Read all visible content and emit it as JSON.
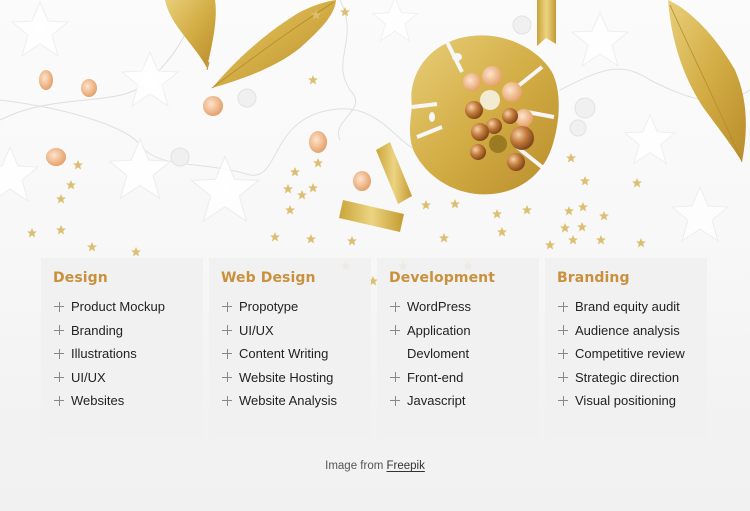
{
  "hero": {
    "image_description": "Flat lay of gold feathers, gold monstera leaf dish with copper beads, gold star confetti and peach crystal beads on white",
    "accent_color": "#c9913d",
    "gold_color": "#d4b04a"
  },
  "cards": [
    {
      "title": "Design",
      "items": [
        {
          "label": "Product Mockup",
          "bullet": true
        },
        {
          "label": "Branding",
          "bullet": true
        },
        {
          "label": "Illustrations",
          "bullet": true
        },
        {
          "label": "UI/UX",
          "bullet": true
        },
        {
          "label": "Websites",
          "bullet": true
        }
      ]
    },
    {
      "title": "Web Design",
      "items": [
        {
          "label": "Propotype",
          "bullet": true
        },
        {
          "label": "UI/UX",
          "bullet": true
        },
        {
          "label": "Content Writing",
          "bullet": true
        },
        {
          "label": "Website Hosting",
          "bullet": true
        },
        {
          "label": "Website Analysis",
          "bullet": true
        }
      ]
    },
    {
      "title": "Development",
      "items": [
        {
          "label": "WordPress",
          "bullet": true
        },
        {
          "label": "Application",
          "bullet": true
        },
        {
          "label": "Devloment",
          "bullet": false
        },
        {
          "label": "Front-end",
          "bullet": true
        },
        {
          "label": "Javascript",
          "bullet": true
        }
      ]
    },
    {
      "title": "Branding",
      "items": [
        {
          "label": "Brand equity audit",
          "bullet": true
        },
        {
          "label": "Audience analysis",
          "bullet": true
        },
        {
          "label": "Competitive review",
          "bullet": true
        },
        {
          "label": "Strategic direction",
          "bullet": true
        },
        {
          "label": "Visual positioning",
          "bullet": true
        }
      ]
    }
  ],
  "credit": {
    "prefix": "Image from ",
    "link_label": "Freepik"
  },
  "icons": {
    "list_bullet": "plus-icon"
  }
}
